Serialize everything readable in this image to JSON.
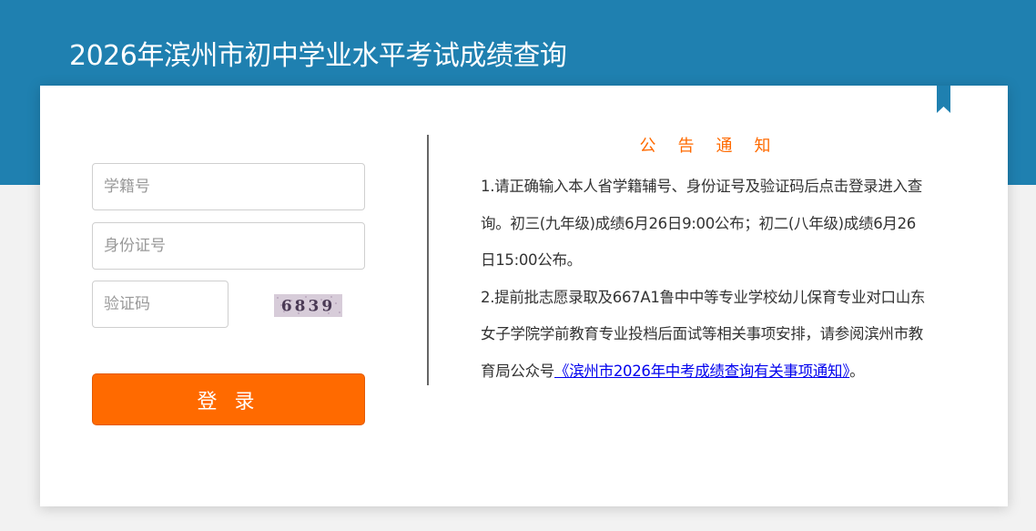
{
  "header": {
    "title": "2026年滨州市初中学业水平考试成绩查询"
  },
  "login_form": {
    "student_id_placeholder": "学籍号",
    "id_card_placeholder": "身份证号",
    "captcha_placeholder": "验证码",
    "captcha_text": "6839",
    "login_label": "登 录"
  },
  "notice": {
    "title": "公告通知",
    "item1_line1": "1.请正确输入本人省学籍辅号、身份证号及验证码后点击登录进",
    "item1_rest": "入查询。初三(九年级)成绩6月26日9:00公布；初二(八年级)成绩6月26日15:00公布。",
    "item2_text": "2.提前批志愿录取及667A1鲁中中等专业学校幼儿保育专业对口山东女子学院学前教育专业投档后面试等相关事项安排，请参阅滨州市教育局公众号",
    "item2_link": "《滨州市2026年中考成绩查询有关事项通知》",
    "item2_end": "。"
  },
  "colors": {
    "banner": "#1f80b0",
    "accent": "#ff6a00",
    "link": "#0000ee"
  }
}
